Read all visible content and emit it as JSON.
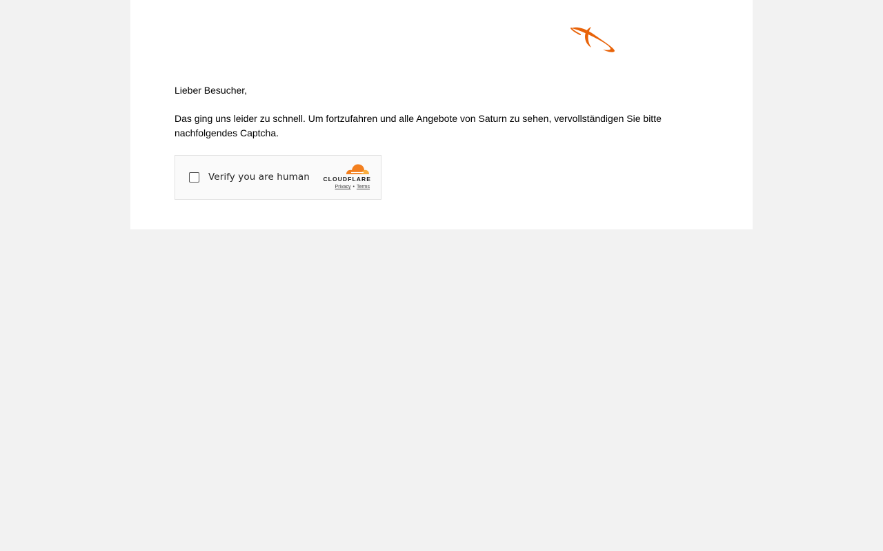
{
  "brand": {
    "logo_icon": "saturn-logo-icon",
    "accent_color": "#e86309"
  },
  "message": {
    "greeting": "Lieber Besucher,",
    "body": "Das ging uns leider zu schnell. Um fortzufahren und alle Angebote von Saturn zu sehen, vervollständigen Sie bitte nachfolgendes Captcha."
  },
  "captcha": {
    "checkbox_checked": false,
    "label": "Verify you are human",
    "provider": "CLOUDFLARE",
    "provider_icon": "cloudflare-cloud-icon",
    "privacy_label": "Privacy",
    "separator": "•",
    "terms_label": "Terms",
    "brand_color": "#f38020"
  }
}
